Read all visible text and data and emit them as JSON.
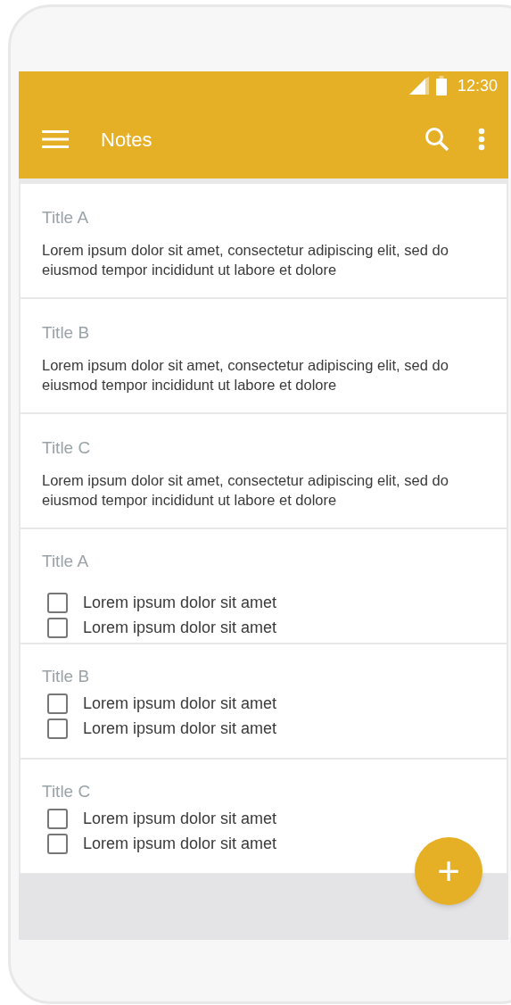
{
  "status_bar": {
    "time": "12:30"
  },
  "toolbar": {
    "title": "Notes"
  },
  "notes": [
    {
      "kind": "text",
      "title": "Title A",
      "body": "Lorem ipsum dolor sit amet, consectetur adipiscing elit, sed do eiusmod tempor incididunt ut labore et dolore"
    },
    {
      "kind": "text",
      "title": "Title B",
      "body": "Lorem ipsum dolor sit amet, consectetur adipiscing elit, sed do eiusmod tempor incididunt ut labore et dolore"
    },
    {
      "kind": "text",
      "title": "Title C",
      "body": "Lorem ipsum dolor sit amet, consectetur adipiscing elit, sed do eiusmod tempor incididunt ut labore et dolore"
    },
    {
      "kind": "checklist",
      "title": "Title A",
      "items": [
        {
          "label": "Lorem ipsum dolor sit amet",
          "checked": false
        },
        {
          "label": "Lorem ipsum dolor sit amet",
          "checked": false
        }
      ]
    },
    {
      "kind": "checklist",
      "title": "Title B",
      "items": [
        {
          "label": "Lorem ipsum dolor sit amet",
          "checked": false
        },
        {
          "label": "Lorem ipsum dolor sit amet",
          "checked": false
        }
      ]
    },
    {
      "kind": "checklist",
      "title": "Title C",
      "items": [
        {
          "label": "Lorem ipsum dolor sit amet",
          "checked": false
        },
        {
          "label": "Lorem ipsum dolor sit amet",
          "checked": false
        }
      ]
    }
  ],
  "fab": {
    "label": "+"
  }
}
